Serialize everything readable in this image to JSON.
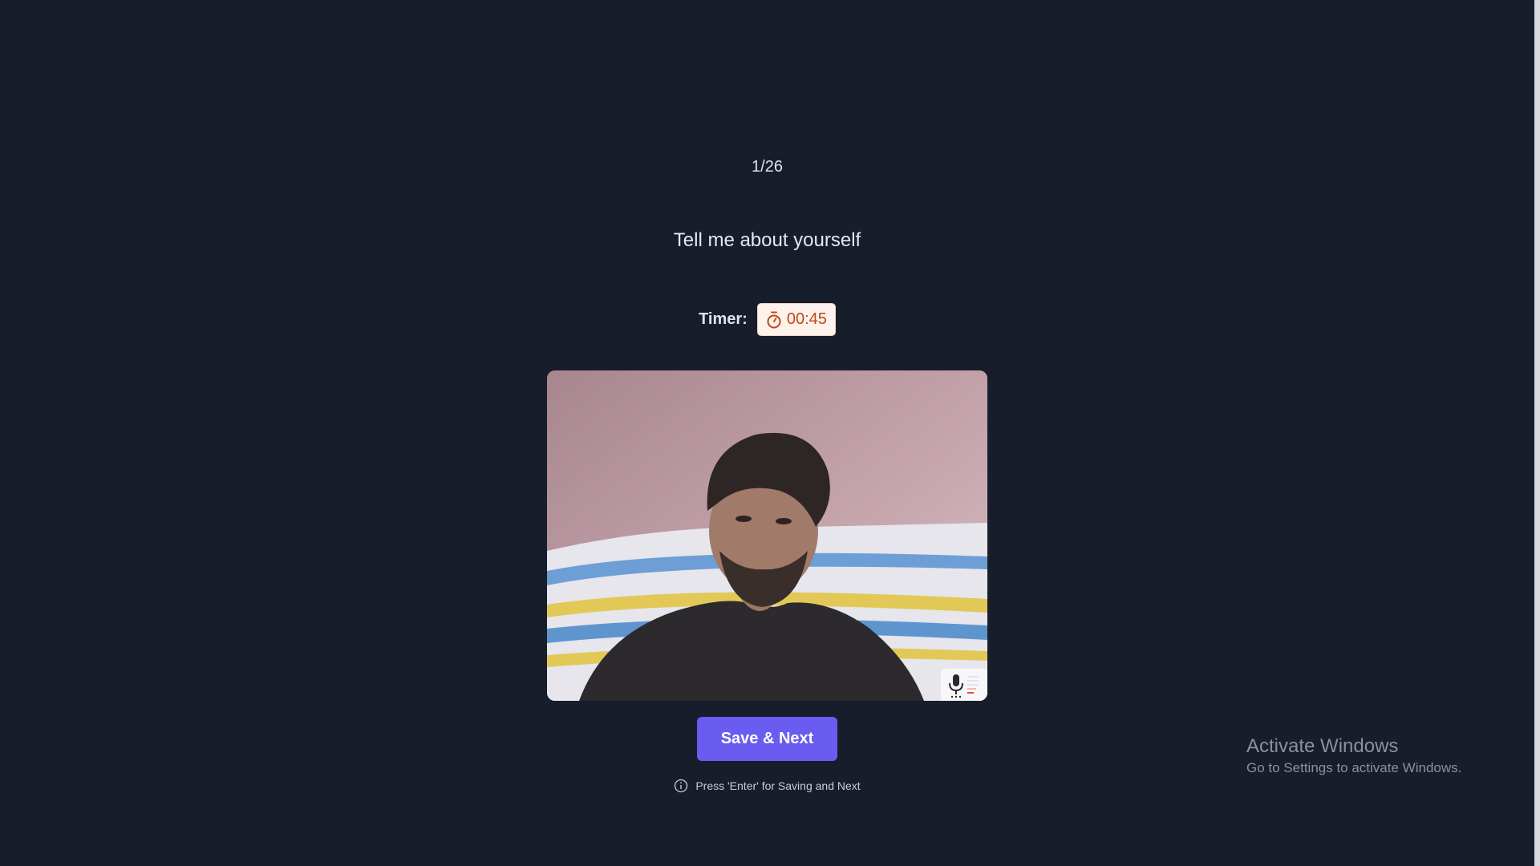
{
  "progress": {
    "text": "1/26",
    "current": 1,
    "total": 26
  },
  "question": {
    "text": "Tell me about yourself"
  },
  "timer": {
    "label": "Timer:",
    "value": "00:45",
    "icon": "stopwatch-icon"
  },
  "video": {
    "mic_icon": "microphone-icon"
  },
  "actions": {
    "save_next_label": "Save & Next"
  },
  "hint": {
    "icon": "info-icon",
    "text": "Press 'Enter' for Saving and Next"
  },
  "watermark": {
    "title": "Activate Windows",
    "subtitle": "Go to Settings to activate Windows."
  },
  "colors": {
    "background": "#181d2b",
    "accent": "#6a5cf0",
    "timer_text": "#c0471a",
    "timer_bg": "#fdf3ec"
  }
}
